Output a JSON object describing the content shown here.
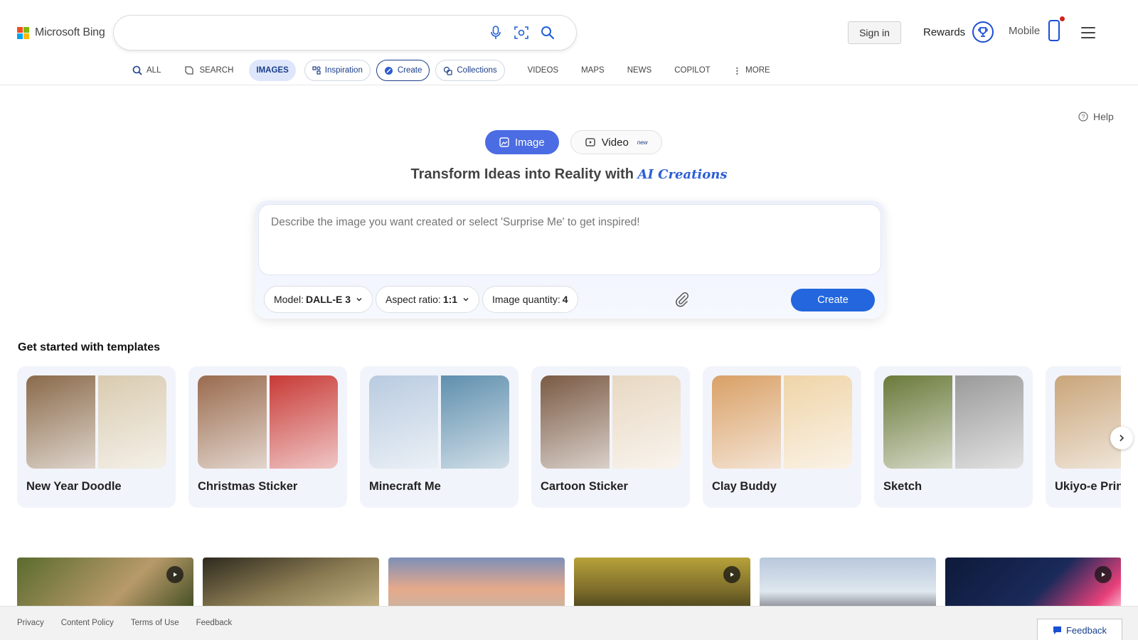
{
  "header": {
    "logo_text": "Microsoft Bing",
    "search_value": "",
    "signin_label": "Sign in",
    "rewards_label": "Rewards",
    "mobile_label": "Mobile"
  },
  "nav": {
    "all": "ALL",
    "search": "SEARCH",
    "images": "IMAGES",
    "inspiration": "Inspiration",
    "create": "Create",
    "collections": "Collections",
    "videos": "VIDEOS",
    "maps": "MAPS",
    "news": "NEWS",
    "copilot": "COPILOT",
    "more": "MORE"
  },
  "creator": {
    "help_label": "Help",
    "tab_image": "Image",
    "tab_video": "Video",
    "tab_video_badge": "new",
    "headline_prefix": "Transform Ideas into Reality with",
    "headline_accent": "AI Creations",
    "prompt_placeholder": "Describe the image you want created or select 'Surprise Me' to get inspired!",
    "model_label": "Model:",
    "model_value": "DALL-E 3",
    "aspect_label": "Aspect ratio:",
    "aspect_value": "1:1",
    "quantity_label": "Image quantity:",
    "quantity_value": "4",
    "create_label": "Create"
  },
  "templates": {
    "title": "Get started with templates",
    "items": [
      {
        "label": "New Year Doodle",
        "colors": [
          "#8a6a4a",
          "#d9cbb0"
        ]
      },
      {
        "label": "Christmas Sticker",
        "colors": [
          "#9a6b4e",
          "#c83a36"
        ]
      },
      {
        "label": "Minecraft Me",
        "colors": [
          "#b9cbe0",
          "#5f8fae"
        ]
      },
      {
        "label": "Cartoon Sticker",
        "colors": [
          "#7a5a44",
          "#e8d8c2"
        ]
      },
      {
        "label": "Clay Buddy",
        "colors": [
          "#d9a066",
          "#efd4a8"
        ]
      },
      {
        "label": "Sketch",
        "colors": [
          "#6a7a3a",
          "#9a9a9a"
        ]
      },
      {
        "label": "Ukiyo-e Print",
        "colors": [
          "#c9a57a",
          "#c9a57a"
        ]
      }
    ]
  },
  "footer": {
    "links": [
      "Privacy",
      "Content Policy",
      "Terms of Use",
      "Feedback"
    ],
    "feedback_button": "Feedback"
  },
  "colors": {
    "accent": "#2366de",
    "image_tab": "#4b6ce2",
    "nav_active_bg": "#dde6fb"
  }
}
